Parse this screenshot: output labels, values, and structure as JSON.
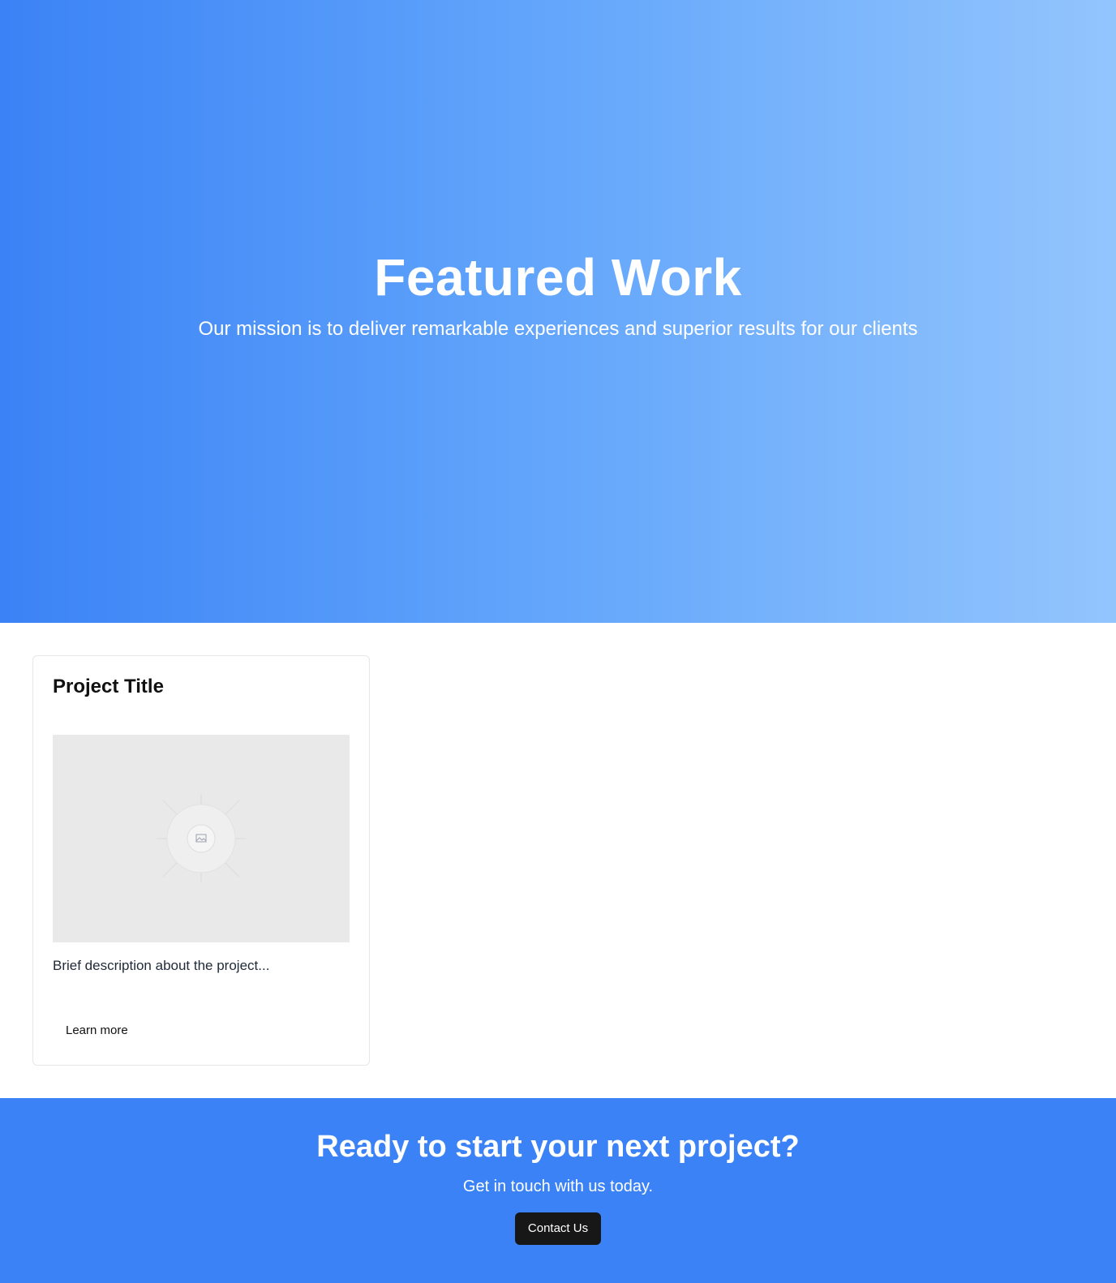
{
  "hero": {
    "title": "Featured Work",
    "subtitle": "Our mission is to deliver remarkable experiences and superior results for our clients",
    "gradient_start": "#3b82f6",
    "gradient_end": "#93c5fd"
  },
  "projects": {
    "items": [
      {
        "title": "Project Title",
        "image_icon": "image-placeholder-icon",
        "description": "Brief description about the project...",
        "link_label": "Learn more"
      }
    ]
  },
  "cta": {
    "title": "Ready to start your next project?",
    "subtitle": "Get in touch with us today.",
    "button_label": "Contact Us",
    "background": "#3b82f6",
    "button_color": "#171717"
  }
}
